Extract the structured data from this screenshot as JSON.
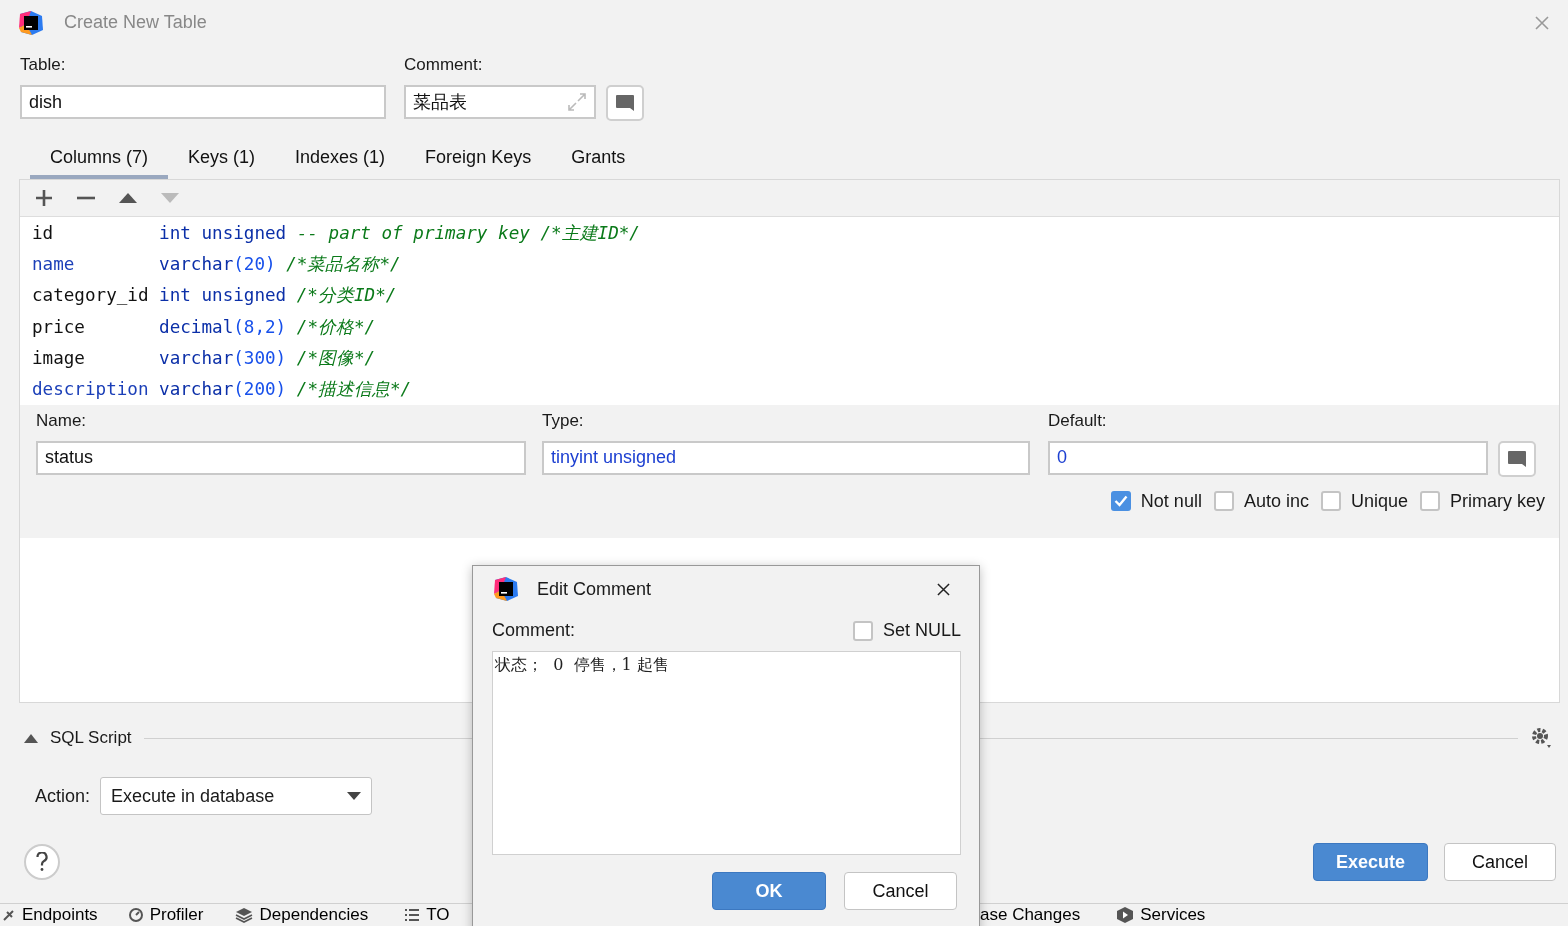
{
  "window": {
    "title": "Create New Table"
  },
  "table_field": {
    "label": "Table:",
    "value": "dish"
  },
  "comment_field": {
    "label": "Comment:",
    "value": "菜品表"
  },
  "tabs": [
    {
      "label": "Columns (7)",
      "selected": true
    },
    {
      "label": "Keys (1)",
      "selected": false
    },
    {
      "label": "Indexes (1)",
      "selected": false
    },
    {
      "label": "Foreign Keys",
      "selected": false
    },
    {
      "label": "Grants",
      "selected": false
    }
  ],
  "columns": [
    {
      "name": "id",
      "name_keyword": false,
      "type": "int unsigned",
      "comment": "-- part of primary key /*主建ID*/"
    },
    {
      "name": "name",
      "name_keyword": true,
      "type": "varchar",
      "args": "(20)",
      "comment": "/*菜品名称*/"
    },
    {
      "name": "category_id",
      "name_keyword": false,
      "type": "int unsigned",
      "comment": "/*分类ID*/"
    },
    {
      "name": "price",
      "name_keyword": false,
      "type": "decimal",
      "args": "(8,2)",
      "comment": "/*价格*/"
    },
    {
      "name": "image",
      "name_keyword": false,
      "type": "varchar",
      "args": "(300)",
      "comment": "/*图像*/"
    },
    {
      "name": "description",
      "name_keyword": true,
      "type": "varchar",
      "args": "(200)",
      "comment": "/*描述信息*/"
    }
  ],
  "column_editor": {
    "name_label": "Name:",
    "name": "status",
    "type_label": "Type:",
    "type": "tinyint unsigned",
    "default_label": "Default:",
    "default": "0",
    "options": [
      {
        "label": "Not null",
        "checked": true
      },
      {
        "label": "Auto inc",
        "checked": false
      },
      {
        "label": "Unique",
        "checked": false
      },
      {
        "label": "Primary key",
        "checked": false
      }
    ]
  },
  "sql_script": {
    "label": "SQL Script",
    "expanded": false
  },
  "action": {
    "label": "Action:",
    "value": "Execute in database"
  },
  "buttons": [
    {
      "label": "Execute",
      "primary": true
    },
    {
      "label": "Cancel",
      "primary": false
    }
  ],
  "tool_windows_left": [
    "Endpoints",
    "Profiler",
    "Dependencies",
    "TO"
  ],
  "tool_windows_right": [
    "ase Changes",
    "Services"
  ],
  "dialog": {
    "title": "Edit Comment",
    "label": "Comment:",
    "set_null": {
      "label": "Set NULL",
      "checked": false
    },
    "text": "状态；  0  停售，1 起售",
    "buttons": [
      {
        "label": "OK",
        "primary": true
      },
      {
        "label": "Cancel",
        "primary": false
      }
    ]
  }
}
